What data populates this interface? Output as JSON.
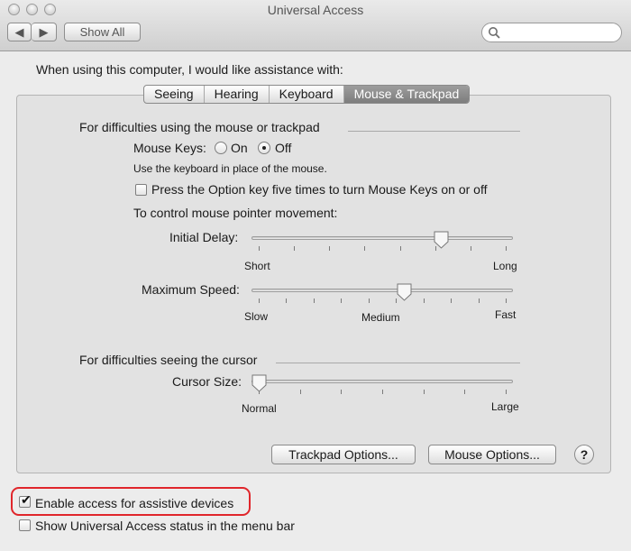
{
  "window": {
    "title": "Universal Access",
    "show_all_label": "Show All",
    "search_placeholder": ""
  },
  "intro": "When using this computer, I would like assistance with:",
  "tabs": [
    {
      "label": "Seeing",
      "active": false
    },
    {
      "label": "Hearing",
      "active": false
    },
    {
      "label": "Keyboard",
      "active": false
    },
    {
      "label": "Mouse & Trackpad",
      "active": true
    }
  ],
  "mouse_section": {
    "title": "For difficulties using the mouse or trackpad",
    "mouse_keys_label": "Mouse Keys:",
    "on_label": "On",
    "off_label": "Off",
    "mouse_keys_value": "Off",
    "mouse_keys_hint": "Use the keyboard in place of the mouse.",
    "option_key_label": "Press the Option key five times to turn Mouse Keys on or off",
    "option_key_checked": false,
    "pointer_heading": "To control mouse pointer movement:",
    "initial_delay": {
      "label": "Initial Delay:",
      "min_label": "Short",
      "max_label": "Long",
      "value": 0.74,
      "ticks": 8
    },
    "maximum_speed": {
      "label": "Maximum Speed:",
      "min_label": "Slow",
      "mid_label": "Medium",
      "max_label": "Fast",
      "value": 0.59,
      "ticks": 10
    }
  },
  "cursor_section": {
    "title": "For difficulties seeing the cursor",
    "cursor_size": {
      "label": "Cursor Size:",
      "min_label": "Normal",
      "max_label": "Large",
      "value": 0.0,
      "ticks": 7
    }
  },
  "buttons": {
    "trackpad_options": "Trackpad Options...",
    "mouse_options": "Mouse Options...",
    "help": "?"
  },
  "footer": {
    "assistive_label": "Enable access for assistive devices",
    "assistive_checked": true,
    "status_label": "Show Universal Access status in the menu bar",
    "status_checked": false
  },
  "colors": {
    "highlight": "#e0262b",
    "active_tab": "#8a8a8a"
  }
}
